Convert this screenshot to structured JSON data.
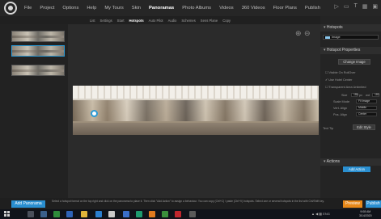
{
  "menubar": {
    "items": [
      "File",
      "Project",
      "Options",
      "Help",
      "My Tours",
      "Skin",
      "Panoramas",
      "Photo Albums",
      "Videos",
      "360 Videos",
      "Floor Plans",
      "Publish"
    ],
    "active_index": 6
  },
  "subbar": {
    "items": [
      "List",
      "Settings",
      "Start",
      "Hotspots",
      "Auto Pilot",
      "Audio",
      "Schemes",
      "Sens Plane",
      "Copy"
    ],
    "active_index": 3
  },
  "right_panel": {
    "hotspots_header": "Hotspots",
    "hotspot_type": "Image",
    "properties_header": "Hotspot Properties",
    "change_image_label": "Change Image",
    "visible_on_rollover": "Visible On RollOver",
    "use_hotel_center": "Use Hotel Center",
    "transparent_area_unlimited": "Transparent Area Unlimited",
    "size_label": "Size",
    "size_values": [
      "180",
      "px",
      "wd",
      "180"
    ],
    "scale_mode_label": "Scale Mode",
    "scale_mode_value": "Fit Image",
    "vert_align_label": "Vert. Align",
    "vert_align_value": "Middle",
    "pos_align_label": "Pos. Align",
    "pos_align_value": "Center",
    "text_tip_label": "Text Tip",
    "edit_style_label": "Edit Style",
    "actions_header": "Actions",
    "add_action_label": "Add Action"
  },
  "statusbar": {
    "add_panorama_label": "Add Panorama",
    "help_text": "Select a hotspot format on the top right and click on the panorama to place it. Then click \"Add Action\" to assign a behaviour. You can copy (Ctrl+C) / paste (Ctrl+V) hotspots. Select one or several hotspots in the list with Ctrl/Shift key.",
    "preview_label": "Preview",
    "publish_label": "Publish"
  },
  "taskbar": {
    "tray_text": "▲ ◀ ▦ ENG",
    "time": "9:08 AM",
    "date": "3/14/2020"
  },
  "icons": {
    "zoom_in": "zoom-in-icon",
    "zoom_out": "zoom-out-icon",
    "top_right": [
      "play-icon",
      "window-icon",
      "text-icon",
      "grid-icon",
      "image-icon"
    ]
  },
  "colors": {
    "accent_blue": "#2a8fd0",
    "preview_orange": "#e8891a"
  }
}
